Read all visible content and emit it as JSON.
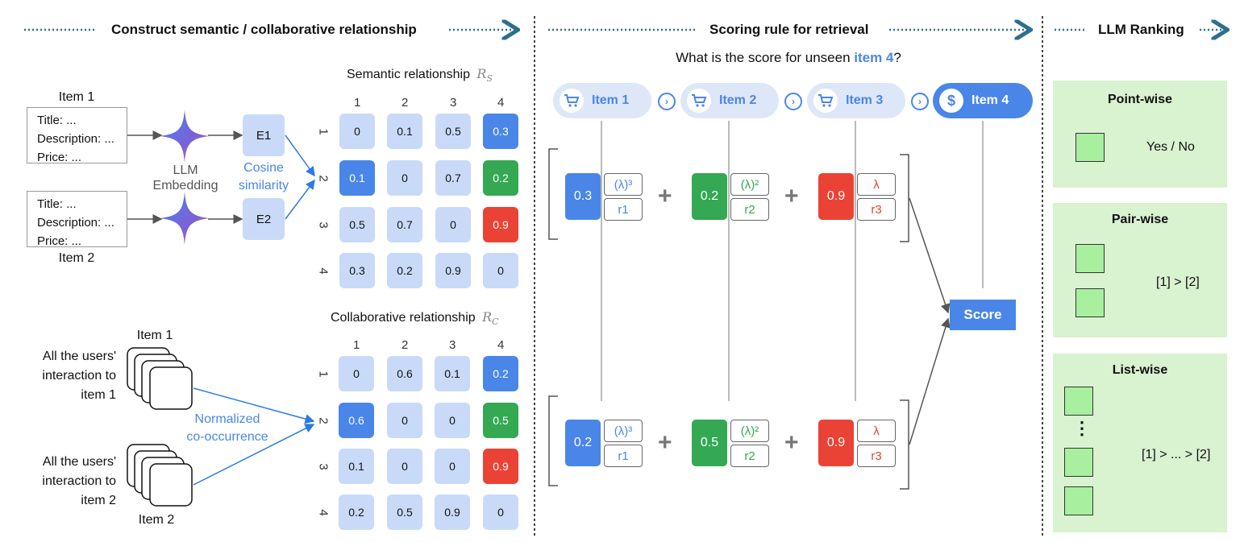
{
  "headers": {
    "left": "Construct semantic / collaborative relationship",
    "middle": "Scoring rule for retrieval",
    "right": "LLM Ranking"
  },
  "semantic": {
    "items": [
      {
        "name": "Item 1",
        "lines": [
          "Title: ...",
          "Description: ...",
          "Price: ..."
        ]
      },
      {
        "name": "Item 2",
        "lines": [
          "Title: ...",
          "Description: ...",
          "Price: ..."
        ]
      }
    ],
    "llm_label": "LLM\nEmbedding",
    "llm_label_1": "LLM",
    "llm_label_2": "Embedding",
    "emb1": "E1",
    "emb2": "E2",
    "cosine_1": "Cosine",
    "cosine_2": "similarity",
    "title": "Semantic relationship",
    "symbol": "R",
    "symbol_sub": "S",
    "col_labels": [
      "1",
      "2",
      "3",
      "4"
    ],
    "row_labels": [
      "1",
      "2",
      "3",
      "4"
    ],
    "matrix": [
      [
        "0",
        "0.1",
        "0.5",
        "0.3"
      ],
      [
        "0.1",
        "0",
        "0.7",
        "0.2"
      ],
      [
        "0.5",
        "0.7",
        "0",
        "0.9"
      ],
      [
        "0.3",
        "0.2",
        "0.9",
        "0"
      ]
    ]
  },
  "collaborative": {
    "item1_label": "Item 1",
    "item2_label": "Item 2",
    "users1": [
      "All the users'",
      "interaction to",
      "item 1"
    ],
    "users2": [
      "All the users'",
      "interaction to",
      "item 2"
    ],
    "method_1": "Normalized",
    "method_2": "co-occurrence",
    "title": "Collaborative relationship",
    "symbol": "R",
    "symbol_sub": "C",
    "col_labels": [
      "1",
      "2",
      "3",
      "4"
    ],
    "row_labels": [
      "1",
      "2",
      "3",
      "4"
    ],
    "matrix": [
      [
        "0",
        "0.6",
        "0.1",
        "0.2"
      ],
      [
        "0.6",
        "0",
        "0",
        "0.5"
      ],
      [
        "0.1",
        "0",
        "0",
        "0.9"
      ],
      [
        "0.2",
        "0.5",
        "0.9",
        "0"
      ]
    ]
  },
  "scoring": {
    "question_prefix": "What is the score for unseen ",
    "question_item": "item 4",
    "question_suffix": "?",
    "pills": [
      "Item 1",
      "Item 2",
      "Item 3",
      "Item 4"
    ],
    "pill_icon": "cart-icon",
    "target_icon": "dollar-icon",
    "dollar_glyph": "$",
    "rows": [
      {
        "values": [
          "0.3",
          "0.2",
          "0.9"
        ],
        "weights": [
          "(λ)³",
          "(λ)²",
          "λ"
        ],
        "rels": [
          "r1",
          "r2",
          "r3"
        ]
      },
      {
        "values": [
          "0.2",
          "0.5",
          "0.9"
        ],
        "weights": [
          "(λ)³",
          "(λ)²",
          "λ"
        ],
        "rels": [
          "r1",
          "r2",
          "r3"
        ]
      }
    ],
    "score_label": "Score"
  },
  "ranking": {
    "pointwise_title": "Point-wise",
    "pointwise_output": "Yes / No",
    "pairwise_title": "Pair-wise",
    "pairwise_output": "[1] > [2]",
    "listwise_title": "List-wise",
    "listwise_output": "[1] > ... > [2]",
    "ellipsis": "⋮"
  },
  "colors": {
    "blue": "#4a86e8",
    "green": "#34a853",
    "red": "#ea4335",
    "light_blue": "#c9daf8",
    "panel_green": "#d9f2d0",
    "box_green": "#a8f0a0",
    "header_arrow": "#2e6e8e"
  }
}
